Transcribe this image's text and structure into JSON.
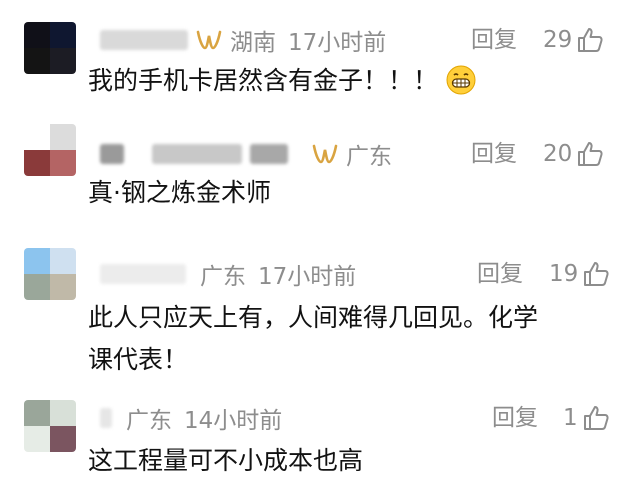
{
  "comments": [
    {
      "location": "湖南",
      "time": "17小时前",
      "reply_label": "回复",
      "likes": "29",
      "text": "我的手机卡居然含有金子！！！",
      "emoji": "grinning-face-emoji",
      "avatar_colors": [
        "#101018",
        "#0f1730",
        "#141414",
        "#1c1c24"
      ],
      "badge": true
    },
    {
      "location": "广东",
      "time": "",
      "reply_label": "回复",
      "likes": "20",
      "text": "真·钢之炼金术师",
      "avatar_colors": [
        "#ffffff",
        "#dcdcdc",
        "#8a3a3a",
        "#b46464"
      ],
      "badge": true
    },
    {
      "location": "广东",
      "time": "17小时前",
      "reply_label": "回复",
      "likes": "19",
      "text": "此人只应天上有，人间难得几回见。化学课代表！",
      "text_line1": "此人只应天上有，人间难得几回见。化学",
      "text_line2": "课代表！",
      "avatar_colors": [
        "#8cc4ee",
        "#cfe0f0",
        "#9aa79a",
        "#c0b9a8"
      ],
      "badge": false
    },
    {
      "location": "广东",
      "time": "14小时前",
      "reply_label": "回复",
      "likes": "1",
      "text": "这工程量可不小成本也高",
      "avatar_colors": [
        "#9aa69a",
        "#d8e0d8",
        "#e6ece6",
        "#7b5560"
      ],
      "badge": false
    }
  ],
  "icons": {
    "like": "thumbs-up-icon",
    "badge": "gold-w-badge-icon"
  },
  "colors": {
    "meta_text": "#8d8d8d",
    "body_text": "#121212",
    "badge_gold": "#d9a441"
  }
}
